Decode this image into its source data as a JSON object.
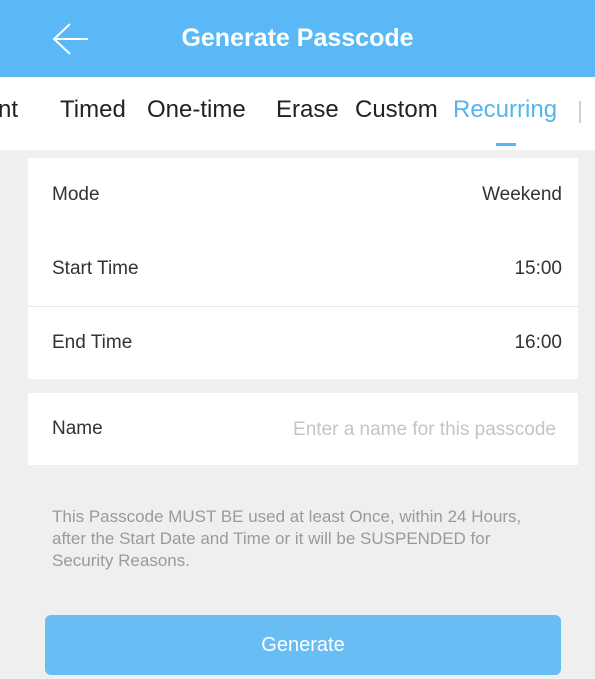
{
  "header": {
    "title": "Generate Passcode",
    "back_icon": "arrow-left-icon"
  },
  "tabs": {
    "items": [
      {
        "label": "nt"
      },
      {
        "label": "Timed"
      },
      {
        "label": "One-time"
      },
      {
        "label": "Erase"
      },
      {
        "label": "Custom"
      },
      {
        "label": "Recurring",
        "active": true
      }
    ],
    "active_color": "#56b4f0"
  },
  "settings": {
    "mode": {
      "label": "Mode",
      "value": "Weekend"
    },
    "start_time": {
      "label": "Start Time",
      "value": "15:00"
    },
    "end_time": {
      "label": "End Time",
      "value": "16:00"
    }
  },
  "name_field": {
    "label": "Name",
    "value": "",
    "placeholder": "Enter a name for this passcode"
  },
  "notice": "This Passcode MUST BE used at least Once, within 24 Hours, after the Start Date and Time or it will be SUSPENDED for Security Reasons.",
  "generate_button": {
    "label": "Generate"
  },
  "colors": {
    "header": "#59b8f5",
    "button": "#68bdf5",
    "background": "#efefef"
  }
}
